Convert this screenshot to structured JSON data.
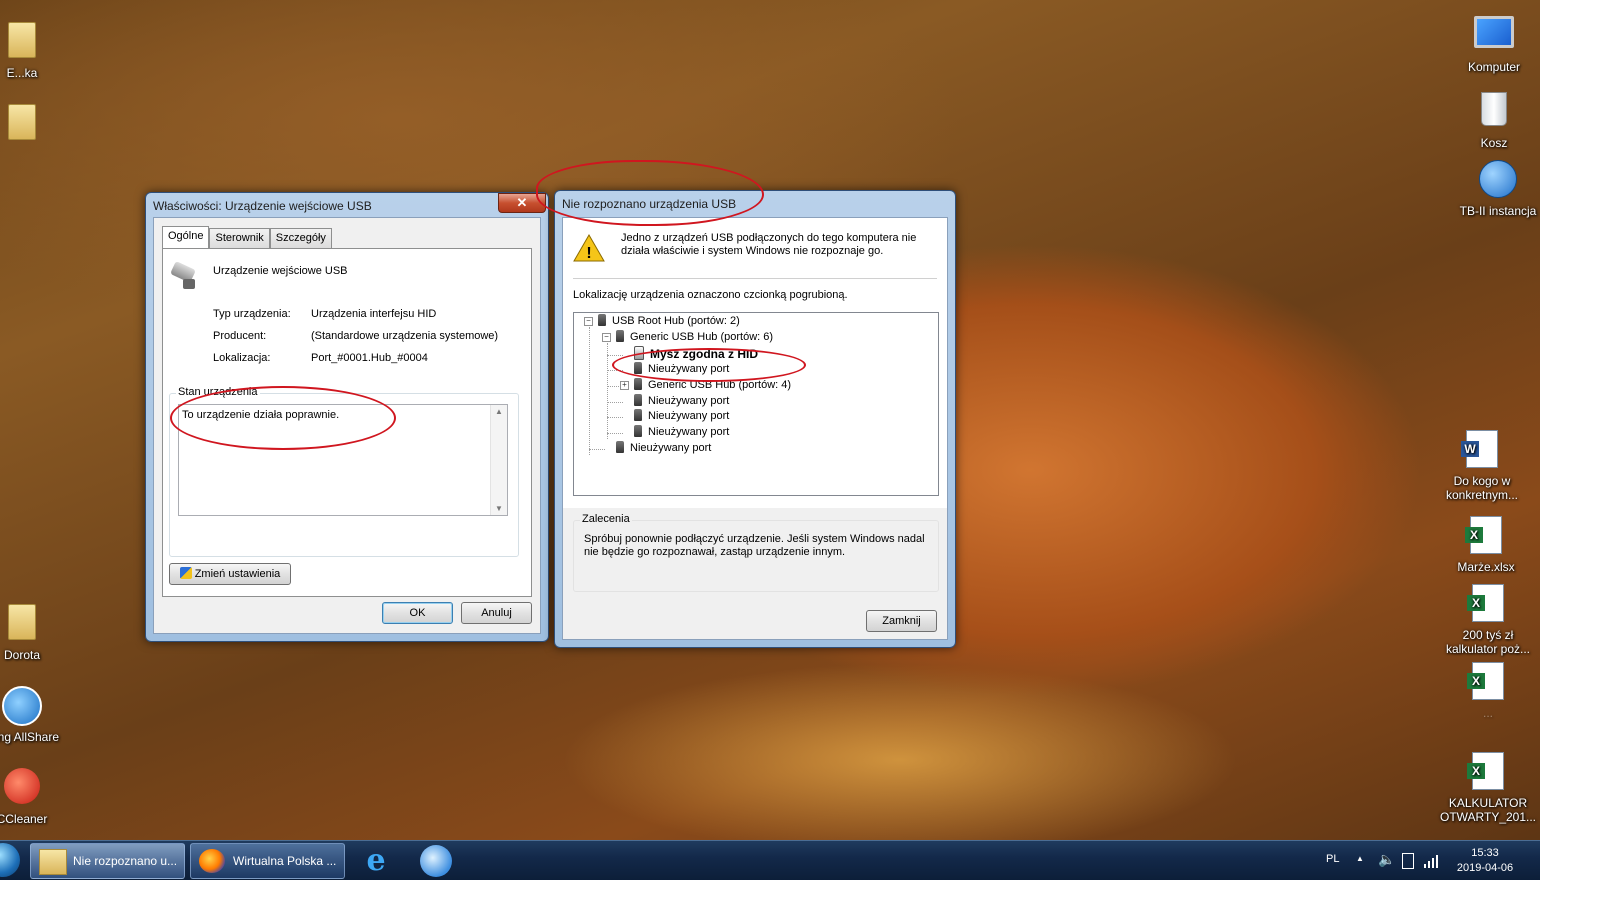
{
  "desktop": {
    "icons_left": [
      {
        "label": "E...ka"
      },
      {
        "label": ""
      },
      {
        "label": "Dorota"
      },
      {
        "label": "sung AllShare"
      },
      {
        "label": "CCleaner"
      }
    ],
    "icons_right": [
      {
        "label": "Komputer"
      },
      {
        "label": "Kosz"
      },
      {
        "label": "TB-II instancja"
      },
      {
        "label": "Do kogo w konkretnym..."
      },
      {
        "label": "Marże.xlsx"
      },
      {
        "label": "200 tyś zł kalkulator poż..."
      },
      {
        "label": "..."
      },
      {
        "label": "KALKULATOR OTWARTY_201..."
      }
    ]
  },
  "properties_dialog": {
    "title": "Właściwości: Urządzenie wejściowe USB",
    "close_label": "✕",
    "tabs": [
      "Ogólne",
      "Sterownik",
      "Szczegóły"
    ],
    "device_name": "Urządzenie wejściowe USB",
    "fields": [
      {
        "label": "Typ urządzenia:",
        "value": "Urządzenia interfejsu HID"
      },
      {
        "label": "Producent:",
        "value": "(Standardowe urządzenia systemowe)"
      },
      {
        "label": "Lokalizacja:",
        "value": "Port_#0001.Hub_#0004"
      }
    ],
    "status_group_title": "Stan urządzenia",
    "status_text": "To urządzenie działa poprawnie.",
    "change_settings_button": "Zmień ustawienia",
    "ok_button": "OK",
    "cancel_button": "Anuluj"
  },
  "usb_dialog": {
    "title": "Nie rozpoznano urządzenia USB",
    "message": "Jedno z urządzeń USB podłączonych do tego komputera nie działa właściwie i system Windows nie rozpoznaje go.",
    "location_hint": "Lokalizację urządzenia oznaczono czcionką pogrubioną.",
    "tree": [
      {
        "label": "USB Root Hub (portów: 2)",
        "level": 0,
        "expander": "-"
      },
      {
        "label": "Generic USB Hub (portów: 6)",
        "level": 1,
        "expander": "-"
      },
      {
        "label": "Mysz zgodna z HID",
        "level": 2,
        "bold": true
      },
      {
        "label": "Nieużywany port",
        "level": 2
      },
      {
        "label": "Generic USB Hub (portów: 4)",
        "level": 2,
        "expander": "+"
      },
      {
        "label": "Nieużywany port",
        "level": 2
      },
      {
        "label": "Nieużywany port",
        "level": 2
      },
      {
        "label": "Nieużywany port",
        "level": 2
      },
      {
        "label": "Nieużywany port",
        "level": 1
      }
    ],
    "recommendation_title": "Zalecenia",
    "recommendation_text": "Spróbuj ponownie podłączyć urządzenie. Jeśli system Windows nadal nie będzie go rozpoznawał, zastąp urządzenie innym.",
    "close_button": "Zamknij"
  },
  "taskbar": {
    "buttons": [
      {
        "label": "Nie rozpoznano u..."
      },
      {
        "label": "Wirtualna Polska ..."
      }
    ],
    "language": "PL",
    "time": "15:33",
    "date": "2019-04-06"
  }
}
